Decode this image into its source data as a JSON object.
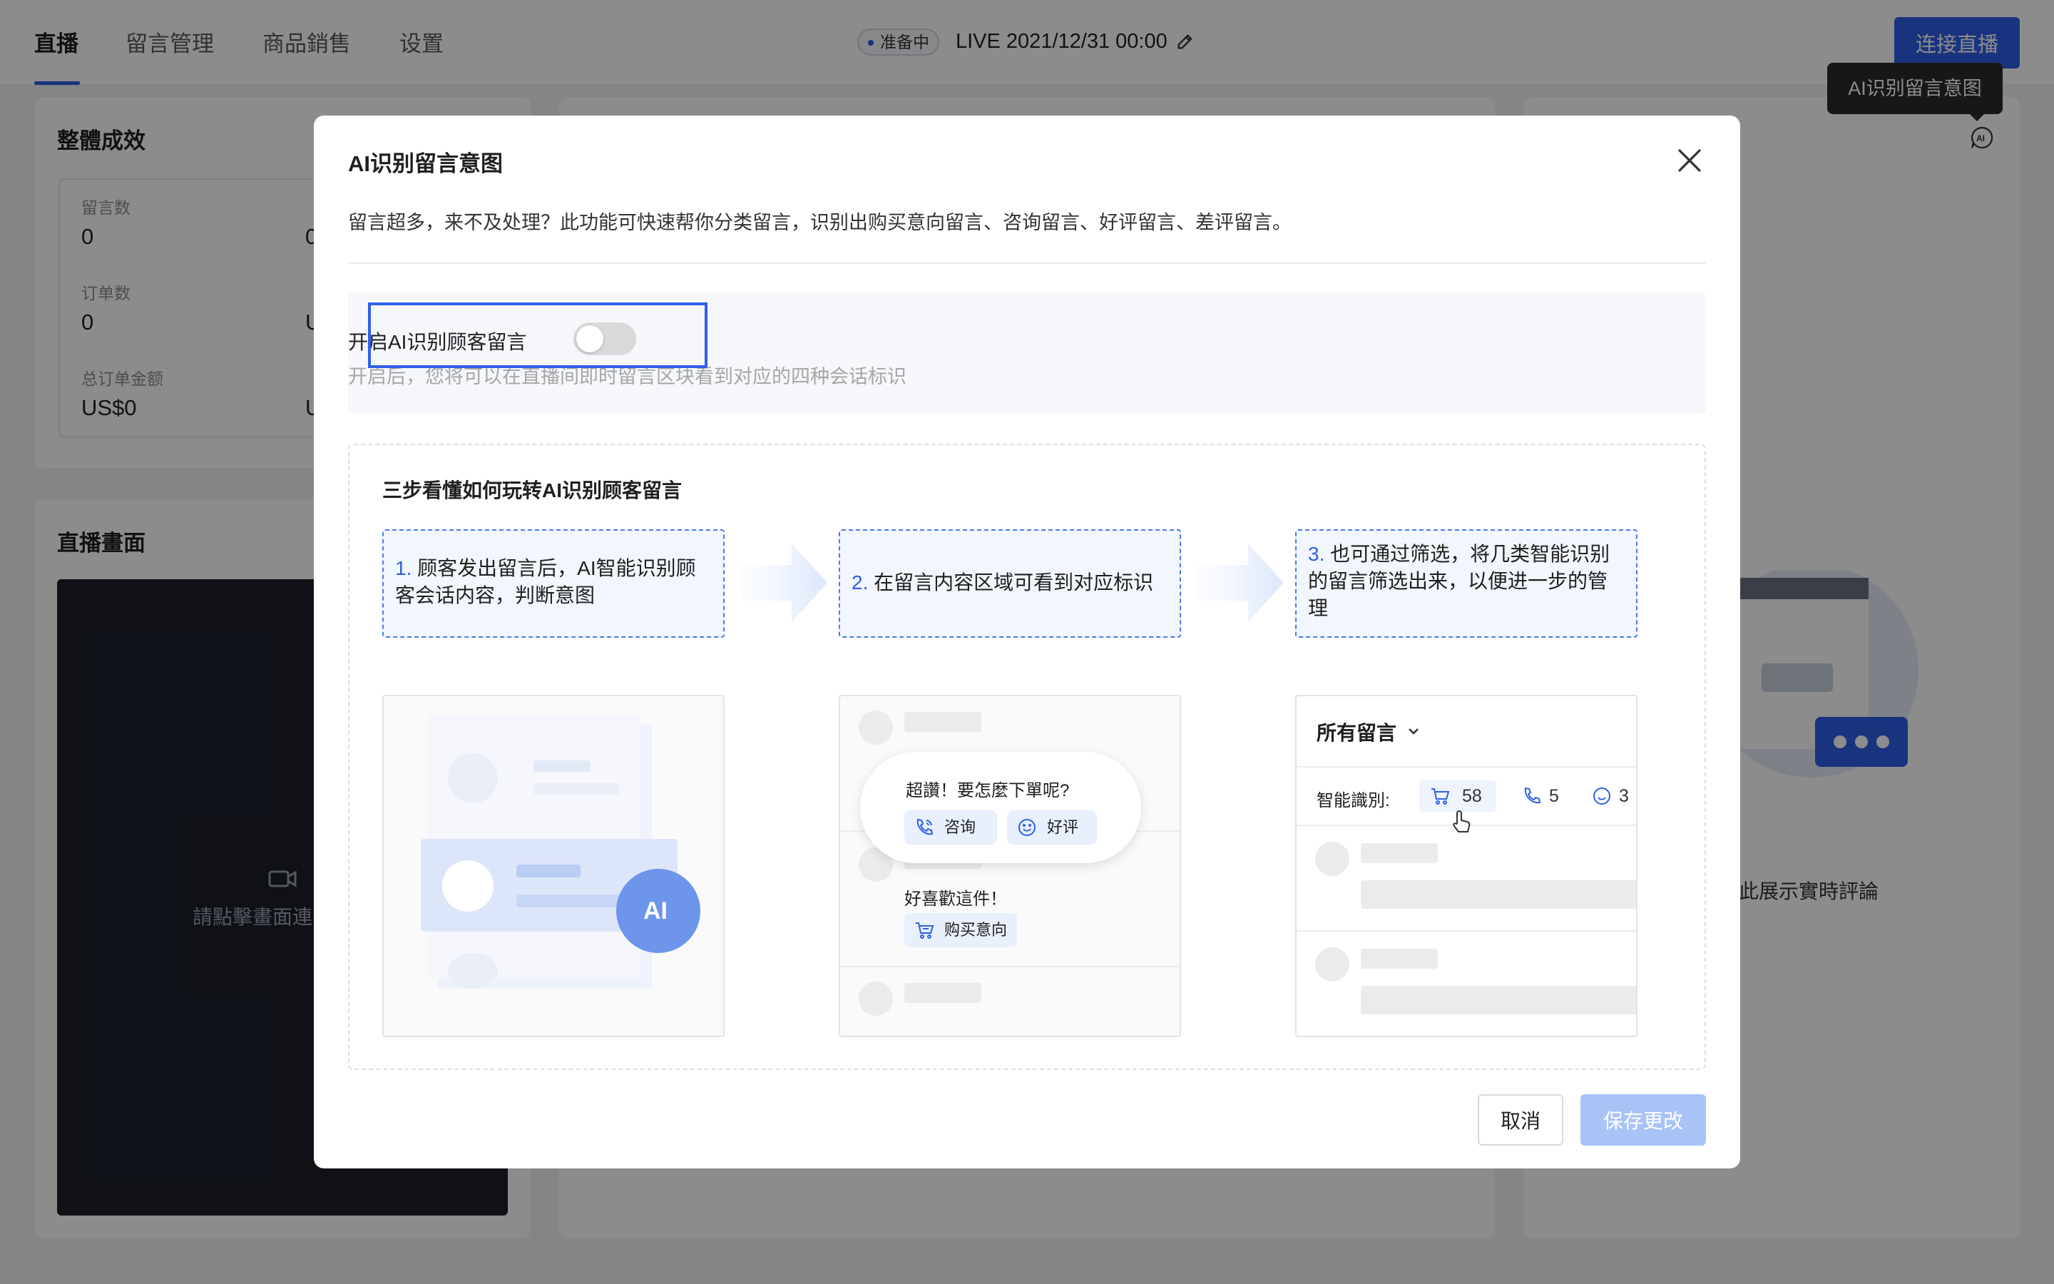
{
  "nav": {
    "tabs": [
      {
        "label": "直播",
        "active": true
      },
      {
        "label": "留言管理",
        "active": false
      },
      {
        "label": "商品銷售",
        "active": false
      },
      {
        "label": "设置",
        "active": false
      }
    ]
  },
  "live": {
    "status": "准备中",
    "time": "LIVE 2021/12/31 00:00",
    "connect_label": "连接直播"
  },
  "tooltip": {
    "text": "AI识别留言意图"
  },
  "overview": {
    "title": "整體成效",
    "stats": [
      {
        "label": "留言数",
        "value": "0"
      },
      {
        "label": "订单数",
        "value": "0"
      },
      {
        "label": "总订单金额",
        "value": "US$0"
      }
    ],
    "partial_second_column": [
      "0",
      "U",
      "U"
    ]
  },
  "stream": {
    "title": "直播畫面",
    "hint": "請點擊畫面連"
  },
  "comments_panel": {
    "hint": "於此展示實時評論"
  },
  "modal": {
    "title": "AI识别留言意图",
    "description": "留言超多，来不及处理？此功能可快速帮你分类留言，识别出购买意向留言、咨询留言、好评留言、差评留言。",
    "toggle": {
      "label": "开启AI识别顾客留言",
      "enabled": false,
      "hint": "开启后，您将可以在直播间即时留言区块看到对应的四种会话标识"
    },
    "guide": {
      "title": "三步看懂如何玩转AI识别顾客留言",
      "steps": [
        {
          "num": "1.",
          "text": "顾客发出留言后，AI智能识别顾客会话内容，判断意图"
        },
        {
          "num": "2.",
          "text": "在留言内容区域可看到对应标识"
        },
        {
          "num": "3.",
          "text": "也可通过筛选，将几类智能识别的留言筛选出来，以便进一步的管理"
        }
      ],
      "illus1": {
        "badge": "AI"
      },
      "illus2": {
        "bubble_text": "超讚！要怎麼下單呢?",
        "tag_consult": "咨询",
        "tag_praise": "好评",
        "comment": "好喜歡這件！",
        "tag_buy": "购买意向"
      },
      "illus3": {
        "filter_title": "所有留言",
        "filter_label": "智能識別:",
        "count_buy": "58",
        "count_consult": "5",
        "count_praise": "3"
      }
    },
    "cancel_label": "取消",
    "save_label": "保存更改"
  },
  "colors": {
    "primary": "#2e5fe6",
    "save_disabled": "#a9c3f7",
    "overlay": "rgba(0,0,0,0.45)"
  }
}
